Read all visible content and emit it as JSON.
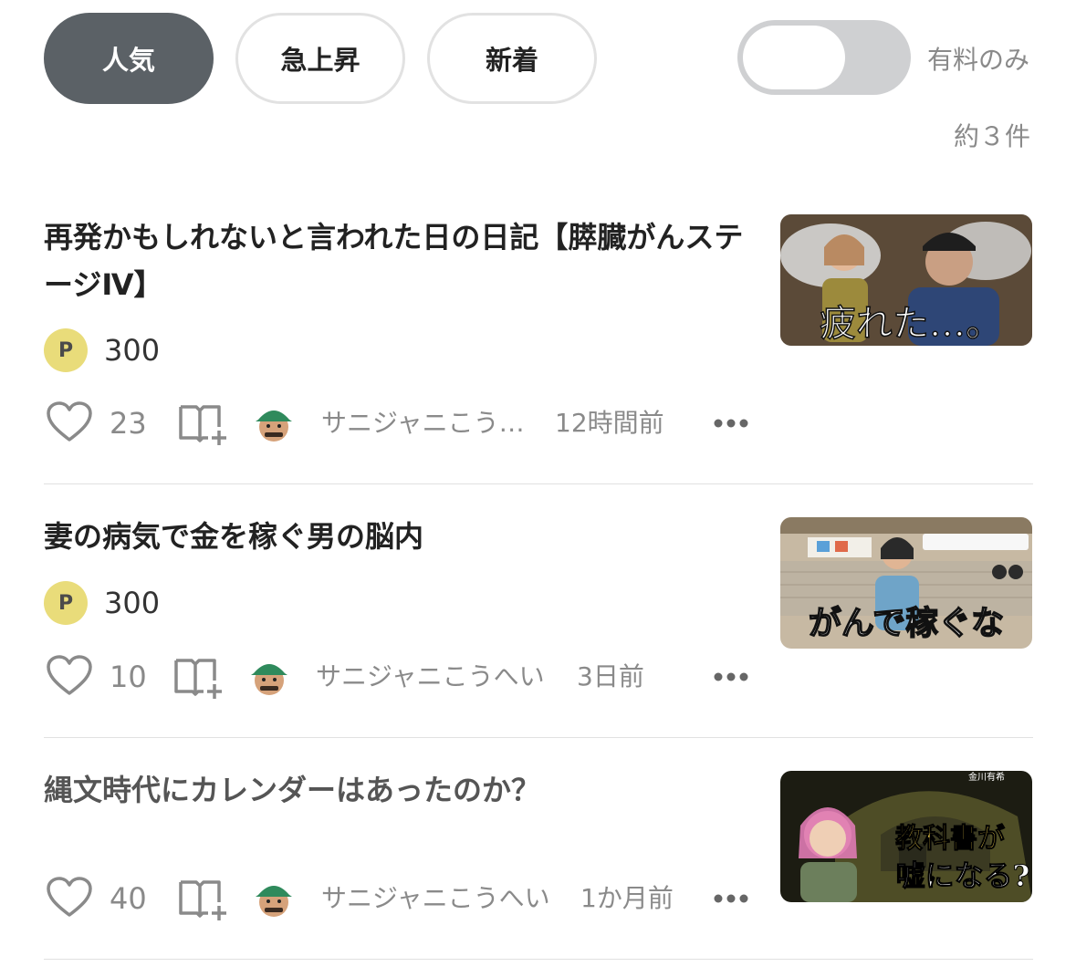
{
  "tabs": {
    "popular": "人気",
    "rising": "急上昇",
    "new": "新着"
  },
  "filter": {
    "paid_only_label": "有料のみ",
    "paid_only_on": false
  },
  "result_count": "約３件",
  "articles": [
    {
      "title": "再発かもしれないと言われた日の日記【膵臓がんステージⅣ】",
      "price_badge": "P",
      "price": "300",
      "likes": "23",
      "author": "サニジャニこう…",
      "time": "12時間前",
      "thumbnail_text": "疲れた…。"
    },
    {
      "title": "妻の病気で金を稼ぐ男の脳内",
      "price_badge": "P",
      "price": "300",
      "likes": "10",
      "author": "サニジャニこうへい",
      "time": "3日前",
      "thumbnail_text": "がんで稼ぐな"
    },
    {
      "title": "縄文時代にカレンダーはあったのか？",
      "likes": "40",
      "author": "サニジャニこうへい",
      "time": "1か月前",
      "thumbnail_text_1": "教科書が",
      "thumbnail_text_2": "嘘になる?",
      "thumbnail_tag": "金川有希"
    }
  ],
  "colors": {
    "active_tab": "#5b6166",
    "coin": "#e9dc7a",
    "muted_text": "#8a8a8a",
    "divider": "#e1e1e1"
  }
}
